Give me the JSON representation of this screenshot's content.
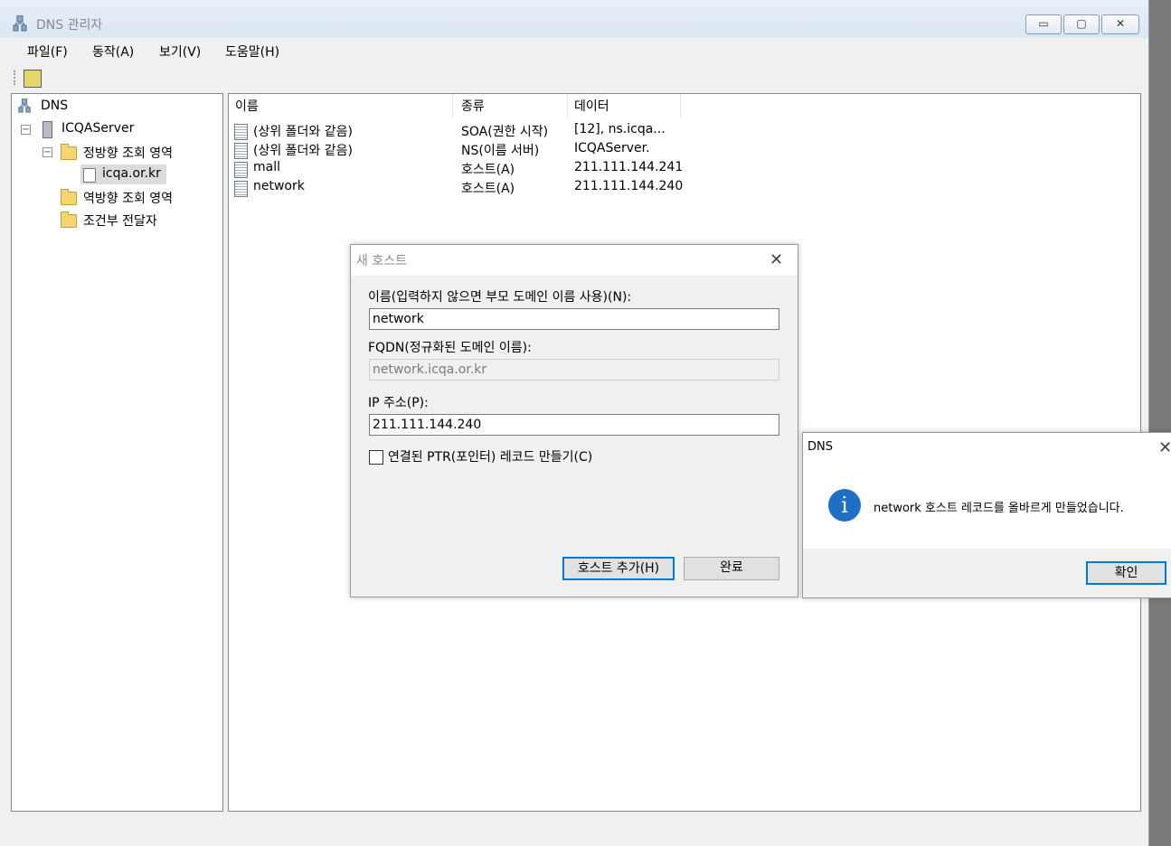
{
  "window": {
    "title": "DNS 관리자",
    "controls": {
      "minimize": "▭",
      "maximize": "▢",
      "close": "✕"
    }
  },
  "menu": [
    "파일(F)",
    "동작(A)",
    "보기(V)",
    "도움말(H)"
  ],
  "tree": {
    "root": "DNS",
    "server": "ICQAServer",
    "forward_zone": "정방향 조회 영역",
    "zone": "icqa.or.kr",
    "reverse_zone": "역방향 조회 영역",
    "forwarders": "조건부 전달자"
  },
  "list": {
    "columns": [
      "이름",
      "종류",
      "데이터"
    ],
    "rows": [
      {
        "name": "(상위 폴더와 같음)",
        "type": "SOA(권한 시작)",
        "data": "[12], ns.icqa..."
      },
      {
        "name": "(상위 폴더와 같음)",
        "type": "NS(이름 서버)",
        "data": "ICQAServer."
      },
      {
        "name": "mall",
        "type": "호스트(A)",
        "data": "211.111.144.241"
      },
      {
        "name": "network",
        "type": "호스트(A)",
        "data": "211.111.144.240"
      }
    ]
  },
  "new_host_dialog": {
    "title": "새 호스트",
    "name_label": "이름(입력하지 않으면 부모 도메인 이름 사용)(N):",
    "name_value": "network",
    "fqdn_label": "FQDN(정규화된 도메인 이름):",
    "fqdn_value": "network.icqa.or.kr",
    "ip_label": "IP 주소(P):",
    "ip_value": "211.111.144.240",
    "ptr_label": "연결된 PTR(포인터) 레코드 만들기(C)",
    "add_button": "호스트 추가(H)",
    "done_button": "완료"
  },
  "message_box": {
    "title": "DNS",
    "text": "network 호스트 레코드를 올바르게 만들었습니다.",
    "ok_button": "확인"
  }
}
